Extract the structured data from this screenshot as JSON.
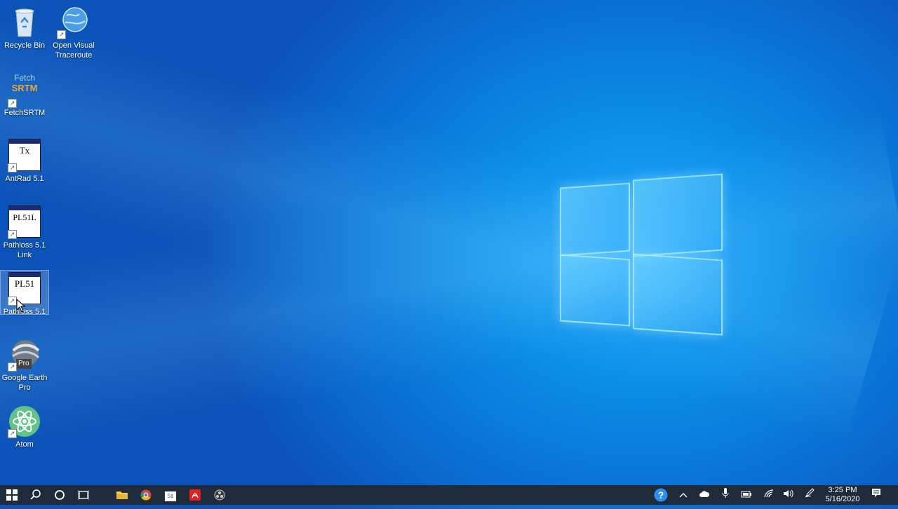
{
  "desktop": {
    "icons": {
      "recycle_bin": "Recycle Bin",
      "visual_traceroute": "Open Visual Traceroute",
      "fetchsrtm": "FetchSRTM",
      "fetchsrtm_art_top": "Fetch",
      "fetchsrtm_art_bottom": "SRTM",
      "antrad": "AntRad 5.1",
      "antrad_art": "Tx",
      "pathloss_link": "Pathloss 5.1 Link",
      "pathloss_link_art": "PL51L",
      "pathloss": "Pathloss 5.1",
      "pathloss_art": "PL51",
      "google_earth": "Google Earth Pro",
      "google_earth_art": "Pro",
      "atom": "Atom"
    }
  },
  "taskbar": {
    "pinned_app_label": "51"
  },
  "clock": {
    "time": "3:25 PM",
    "date": "5/16/2020"
  },
  "colors": {
    "taskbar": "#1f2b3a",
    "desktop_accent": "#0a8ee8"
  }
}
